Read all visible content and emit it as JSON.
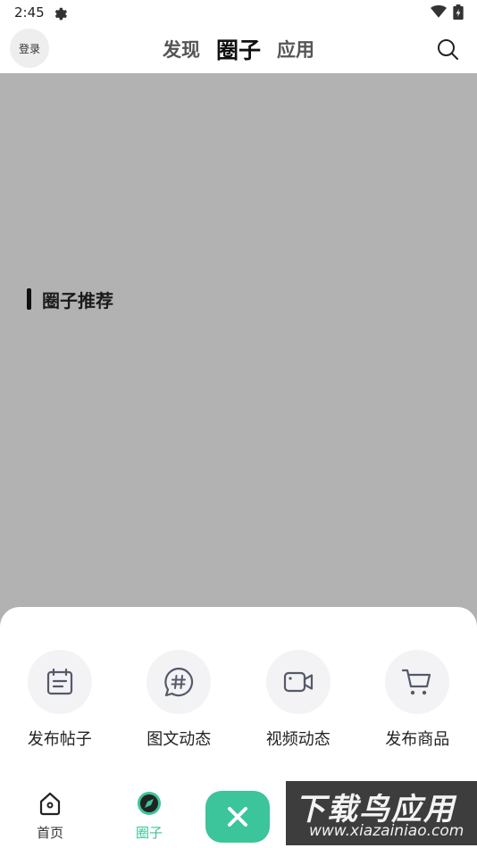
{
  "status_bar": {
    "time": "2:45",
    "settings_icon": "gear-icon",
    "wifi_icon": "wifi-icon",
    "battery_icon": "battery-charging-icon"
  },
  "header": {
    "login_label": "登录",
    "tabs": [
      {
        "label": "发现",
        "active": false
      },
      {
        "label": "圈子",
        "active": true
      },
      {
        "label": "应用",
        "active": false
      }
    ],
    "search_icon": "search-icon"
  },
  "content": {
    "section_title": "圈子推荐"
  },
  "publish_sheet": {
    "actions": [
      {
        "label": "发布帖子",
        "icon": "calendar-note-icon"
      },
      {
        "label": "图文动态",
        "icon": "hashtag-bubble-icon"
      },
      {
        "label": "视频动态",
        "icon": "video-camera-icon"
      },
      {
        "label": "发布商品",
        "icon": "shopping-cart-icon"
      }
    ]
  },
  "bottom_nav": {
    "items": [
      {
        "label": "首页",
        "icon": "home-icon",
        "active": false
      },
      {
        "label": "圈子",
        "icon": "compass-icon",
        "active": true
      }
    ],
    "close_icon": "close-icon",
    "accent_color": "#3cc49a"
  },
  "watermark": {
    "title": "下载鸟应用",
    "subtitle": "www.xiazainiao.com"
  }
}
